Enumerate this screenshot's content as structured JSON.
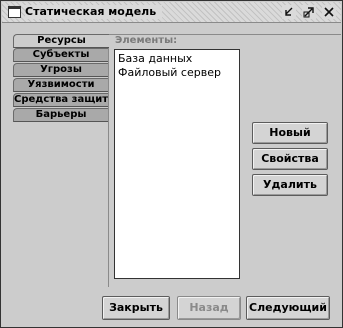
{
  "window": {
    "title": "Статическая модель"
  },
  "tabs": [
    {
      "label": "Ресурсы",
      "active": true
    },
    {
      "label": "Субъекты",
      "active": false
    },
    {
      "label": "Угрозы",
      "active": false
    },
    {
      "label": "Уязвимости",
      "active": false
    },
    {
      "label": "Средства защиты",
      "active": false
    },
    {
      "label": "Барьеры",
      "active": false
    }
  ],
  "elements": {
    "label": "Элементы:",
    "items": [
      "База данных",
      "Файловый сервер"
    ]
  },
  "side_buttons": {
    "new": "Новый",
    "properties": "Свойства",
    "delete": "Удалить"
  },
  "bottom_buttons": {
    "close": "Закрыть",
    "back": "Назад",
    "next": "Следующий"
  },
  "icons": {
    "window": "window-icon",
    "iconify": "iconify-icon",
    "maximize": "maximize-icon",
    "close": "close-icon"
  }
}
